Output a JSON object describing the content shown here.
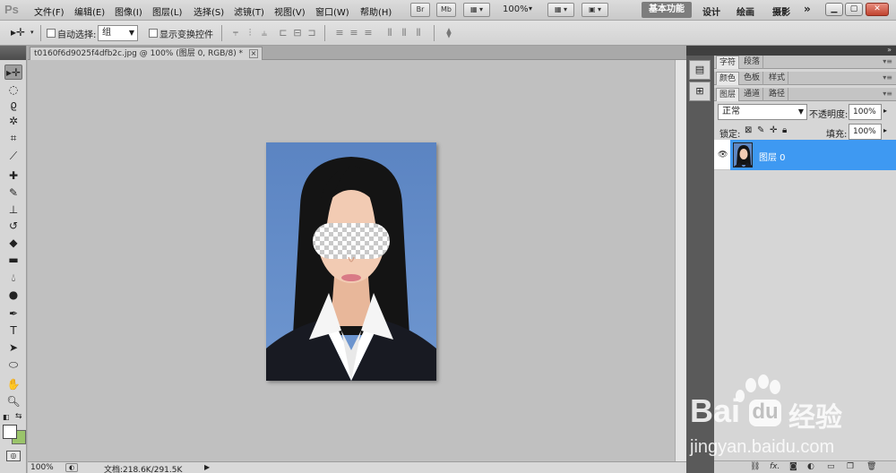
{
  "app": {
    "logo": "Ps",
    "menu": [
      "文件(F)",
      "编辑(E)",
      "图像(I)",
      "图层(L)",
      "选择(S)",
      "滤镜(T)",
      "视图(V)",
      "窗口(W)",
      "帮助(H)"
    ],
    "bridge_button": "Br",
    "minibridge_button": "Mb",
    "zoom": "100%",
    "workspaces": {
      "active": "基本功能",
      "others": [
        "设计",
        "绘画",
        "摄影"
      ],
      "more": "»"
    }
  },
  "options": {
    "auto_select_label": "自动选择:",
    "auto_select_value": "组",
    "show_transform_label": "显示变换控件"
  },
  "document": {
    "tab_title": "t0160f6d9025f4dfb2c.jpg @ 100% (图层 0, RGB/8) *",
    "status_zoom": "100%",
    "status_info": "文档:218.6K/291.5K"
  },
  "panels": {
    "group1_tabs": [
      "字符",
      "段落"
    ],
    "group2_tabs": [
      "颜色",
      "色板",
      "样式"
    ],
    "layers_tabs": [
      "图层",
      "通道",
      "路径"
    ],
    "blend_mode": "正常",
    "opacity_label": "不透明度:",
    "opacity_value": "100%",
    "lock_label": "锁定:",
    "fill_label": "填充:",
    "fill_value": "100%",
    "layers": [
      {
        "name": "图层 0",
        "visible": true,
        "selected": true
      }
    ]
  },
  "watermark": {
    "brand_latin": "Bai",
    "brand_cn": "经验",
    "url": "jingyan.baidu.com"
  },
  "colors": {
    "accent_selected": "#3e99f2",
    "canvas_bg": "#c0c0c0",
    "photo_bg": "#5f88c4"
  }
}
